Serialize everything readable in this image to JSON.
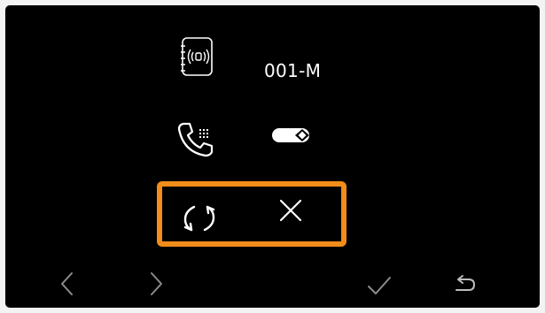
{
  "device": {
    "icon": "address-book-intercom-icon",
    "label": "001-M"
  },
  "call_setting": {
    "icon": "phone-keypad-icon",
    "toggle_icon": "toggle-icon",
    "toggle_state": "on"
  },
  "actions": {
    "refresh_icon": "refresh-icon",
    "delete_icon": "close-icon",
    "highlight_color": "#f28c1a"
  },
  "nav": {
    "prev_icon": "chevron-left-icon",
    "next_icon": "chevron-right-icon",
    "confirm_icon": "check-icon",
    "back_icon": "return-icon"
  },
  "colors": {
    "background": "#000000",
    "foreground": "#ffffff",
    "nav_icon": "#8c8c8c",
    "accent": "#f28c1a"
  }
}
